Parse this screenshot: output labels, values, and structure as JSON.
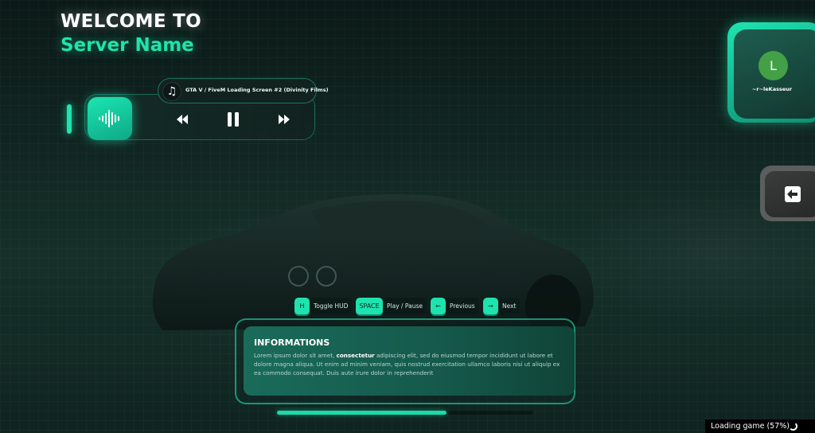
{
  "title": {
    "line1": "WELCOME TO",
    "line2": "Server Name"
  },
  "player": {
    "track": "GTA V / FiveM Loading Screen #2 (Divinity Films)",
    "note_icon": "♫",
    "icons": [
      "soundwave-icon",
      "music-note-icon",
      "rewind-icon",
      "pause-icon",
      "fast-forward-icon"
    ]
  },
  "profile": {
    "avatar_initial": "L",
    "username": "~r~leKasseur",
    "avatar_color": "#43a047"
  },
  "hints": [
    {
      "key": "H",
      "label": "Toggle HUD"
    },
    {
      "key": "SPACE",
      "label": "Play / Pause"
    },
    {
      "key": "←",
      "label": "Previous"
    },
    {
      "key": "→",
      "label": "Next"
    }
  ],
  "info": {
    "title": "INFORMATIONS",
    "text_before": "Lorem ipsum dolor sit amet, ",
    "text_bold": "consectetur",
    "text_after": " adipiscing elit, sed do eiusmod tempor incididunt ut labore et dolore magna aliqua. Ut enim ad minim veniam, quis nostrud exercitation ullamco laboris nisi ut aliquip ex ea commodo consequat. Duis aute irure dolor in reprehenderit"
  },
  "progress": {
    "fraction": 0.66
  },
  "status": {
    "loading_text": "Loading game (57%)"
  },
  "colors": {
    "accent": "#1fe3ab",
    "background": "#112622"
  }
}
